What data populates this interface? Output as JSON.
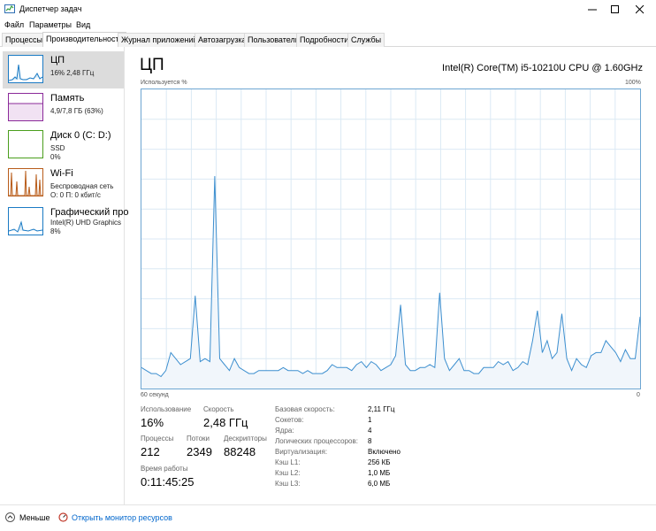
{
  "window": {
    "title": "Диспетчер задач"
  },
  "menu": [
    "Файл",
    "Параметры",
    "Вид"
  ],
  "tabs": [
    "Процессы",
    "Производительность",
    "Журнал приложений",
    "Автозагрузка",
    "Пользователи",
    "Подробности",
    "Службы"
  ],
  "sidebar": [
    {
      "name": "ЦП",
      "sub1": "16% 2,48 ГГц",
      "sub2": "",
      "color": "#1a7ac4"
    },
    {
      "name": "Память",
      "sub1": "4,9/7,8 ГБ (63%)",
      "sub2": "",
      "color": "#8b2a9a"
    },
    {
      "name": "Диск 0 (C: D:)",
      "sub1": "SSD",
      "sub2": "0%",
      "color": "#4a9e1d"
    },
    {
      "name": "Wi-Fi",
      "sub1": "Беспроводная сеть",
      "sub2": "О: 0 П: 0 кбит/с",
      "color": "#b85c1a"
    },
    {
      "name": "Графический про",
      "sub1": "Intel(R) UHD Graphics",
      "sub2": "8%",
      "color": "#1a7ac4"
    }
  ],
  "main": {
    "title": "ЦП",
    "model": "Intel(R) Core(TM) i5-10210U CPU @ 1.60GHz",
    "usage_label": "Используется %",
    "max_label": "100%",
    "time_label": "60 секунд",
    "zero_label": "0"
  },
  "stats": {
    "usage_label": "Использование",
    "usage": "16%",
    "speed_label": "Скорость",
    "speed": "2,48 ГГц",
    "proc_label": "Процессы",
    "proc": "212",
    "threads_label": "Потоки",
    "threads": "2349",
    "handles_label": "Дескрипторы",
    "handles": "88248",
    "uptime_label": "Время работы",
    "uptime": "0:11:45:25"
  },
  "info": [
    {
      "label": "Базовая скорость:",
      "value": "2,11 ГГц"
    },
    {
      "label": "Сокетов:",
      "value": "1"
    },
    {
      "label": "Ядра:",
      "value": "4"
    },
    {
      "label": "Логических процессоров:",
      "value": "8"
    },
    {
      "label": "Виртуализация:",
      "value": "Включено"
    },
    {
      "label": "Кэш L1:",
      "value": "256 КБ"
    },
    {
      "label": "Кэш L2:",
      "value": "1,0 МБ"
    },
    {
      "label": "Кэш L3:",
      "value": "6,0 МБ"
    }
  ],
  "footer": {
    "less": "Меньше",
    "monitor": "Открыть монитор ресурсов"
  },
  "chart_data": {
    "type": "area",
    "ylim": [
      0,
      100
    ],
    "values": [
      7,
      6,
      5,
      5,
      4,
      6,
      12,
      10,
      8,
      9,
      10,
      31,
      9,
      10,
      9,
      71,
      10,
      8,
      6,
      10,
      7,
      6,
      5,
      5,
      6,
      6,
      6,
      6,
      6,
      7,
      6,
      6,
      6,
      5,
      6,
      5,
      5,
      5,
      6,
      8,
      7,
      7,
      7,
      6,
      8,
      9,
      7,
      9,
      8,
      6,
      7,
      8,
      11,
      28,
      8,
      6,
      6,
      7,
      7,
      8,
      7,
      32,
      10,
      6,
      8,
      10,
      6,
      6,
      5,
      5,
      7,
      7,
      7,
      9,
      8,
      9,
      6,
      7,
      9,
      8,
      16,
      26,
      12,
      16,
      10,
      12,
      25,
      10,
      6,
      10,
      8,
      7,
      11,
      12,
      12,
      16,
      14,
      12,
      9,
      13,
      10,
      10,
      24
    ]
  }
}
